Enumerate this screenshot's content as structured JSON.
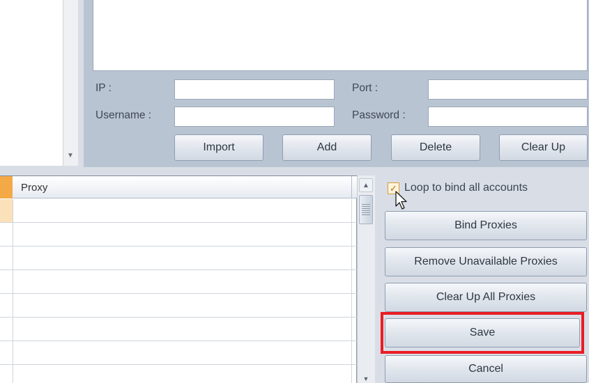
{
  "editor": {
    "ip_label": "IP :",
    "port_label": "Port :",
    "username_label": "Username :",
    "password_label": "Password :",
    "ip_value": "",
    "port_value": "",
    "username_value": "",
    "password_value": "",
    "buttons": {
      "import": "Import",
      "add": "Add",
      "delete": "Delete",
      "clear_up": "Clear Up"
    }
  },
  "grid": {
    "columns": [
      "Proxy"
    ]
  },
  "actions": {
    "loop_label": "Loop to bind all accounts",
    "loop_checked": true,
    "bind_proxies": "Bind Proxies",
    "remove_unavailable": "Remove Unavailable Proxies",
    "clear_up_all": "Clear Up All Proxies",
    "save": "Save",
    "cancel": "Cancel"
  },
  "icons": {
    "check": "✓",
    "scroll_up": "▲",
    "scroll_down": "▼"
  },
  "colors": {
    "highlight": "#ea1c24",
    "selected_header": "#f4a947"
  }
}
